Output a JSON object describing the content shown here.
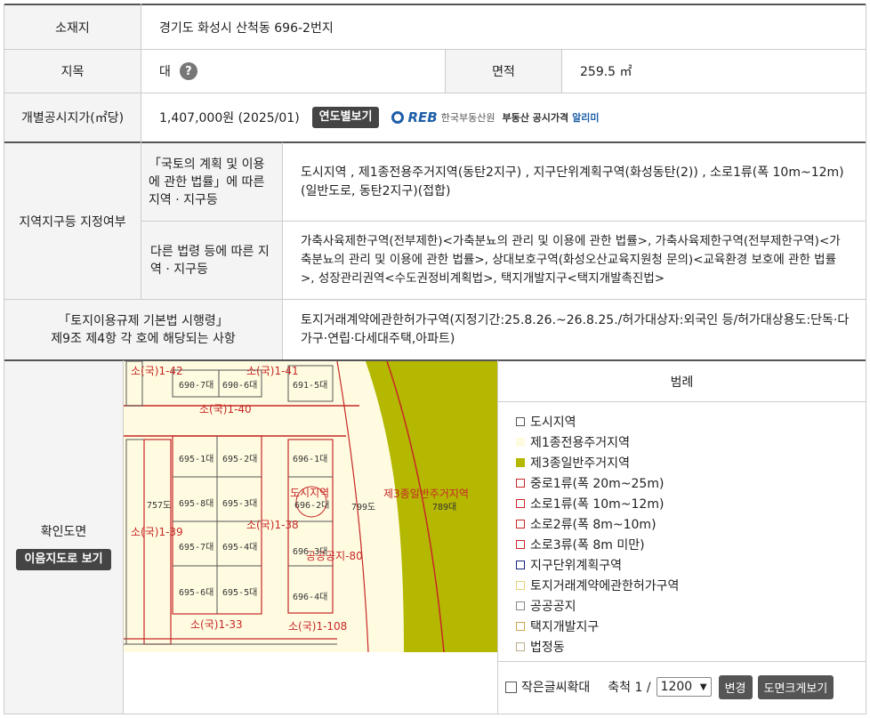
{
  "location": {
    "label": "소재지",
    "value": "경기도 화성시 산척동 696-2번지"
  },
  "jimok": {
    "label": "지목",
    "value": "대",
    "help": "?"
  },
  "area": {
    "label": "면적",
    "value": "259.5 ㎡"
  },
  "price": {
    "label": "개별공시지가(㎡당)",
    "value": "1,407,000원 (2025/01)",
    "button": "연도별보기",
    "reb_logo": "REB",
    "reb_org": "한국부동산원",
    "reb_service": "부동산 공시가격",
    "reb_alimi": "알리미"
  },
  "zoning": {
    "label": "지역지구등 지정여부",
    "national_label": "「국토의 계획 및 이용에 관한 법률」에 따른 지역 · 지구등",
    "national_value": "도시지역 , 제1종전용주거지역(동탄2지구) , 지구단위계획구역(화성동탄(2)) , 소로1류(폭 10m~12m)(일반도로, 동탄2지구)(접합)",
    "other_label": "다른 법령 등에 따른 지역 · 지구등",
    "other_value": "가축사육제한구역(전부제한)<가축분뇨의 관리 및 이용에 관한 법률>, 가축사육제한구역(전부제한구역)<가축분뇨의 관리 및 이용에 관한 법률>, 상대보호구역(화성오산교육지원청 문의)<교육환경 보호에 관한 법률>, 성장관리권역<수도권정비계획법>, 택지개발지구<택지개발촉진법>"
  },
  "regulation": {
    "label_line1": "「토지이용규제 기본법 시행령」",
    "label_line2": "제9조 제4항 각 호에 해당되는 사항",
    "value": "토지거래계약에관한허가구역(지정기간:25.8.26.~26.8.25./허가대상자:외국인 등/허가대상용도:단독·다가구·연립·다세대주택,아파트)"
  },
  "map_section": {
    "label": "확인도면",
    "button": "이음지도로 보기"
  },
  "map_labels": {
    "l1": "소(국)1-42",
    "l2": "소(국)1-41",
    "l3": "소(국)1-40",
    "l4": "소(국)1-39",
    "l5": "소(국)1-38",
    "l6": "소(국)1-33",
    "l7": "소(국)1-108",
    "l8": "공공공지-80",
    "l9": "도시지역",
    "l10": "제3종일반주거지역",
    "p1": "690-7대",
    "p2": "690-6대",
    "p3": "691-5대",
    "p4": "695-1대",
    "p5": "695-2대",
    "p6": "696-1대",
    "p7": "695-8대",
    "p8": "695-3대",
    "p9": "696-2대",
    "p10": "695-7대",
    "p11": "695-4대",
    "p12": "696-3대",
    "p13": "695-6대",
    "p14": "695-5대",
    "p15": "696-4대",
    "p16": "757도",
    "p17": "799도",
    "p18": "789대"
  },
  "legend": {
    "title": "범례",
    "items": [
      {
        "label": "도시지역",
        "fill": "#ffffff",
        "border": "#555555"
      },
      {
        "label": "제1종전용주거지역",
        "fill": "#fffbe0",
        "border": "#fffbe0"
      },
      {
        "label": "제3종일반주거지역",
        "fill": "#b5b800",
        "border": "#b5b800"
      },
      {
        "label": "중로1류(폭 20m~25m)",
        "fill": "#ffffff",
        "border": "#c62828"
      },
      {
        "label": "소로1류(폭 10m~12m)",
        "fill": "#ffffff",
        "border": "#c62828"
      },
      {
        "label": "소로2류(폭 8m~10m)",
        "fill": "#ffffff",
        "border": "#c62828"
      },
      {
        "label": "소로3류(폭 8m 미만)",
        "fill": "#ffffff",
        "border": "#c62828"
      },
      {
        "label": "지구단위계획구역",
        "fill": "#ffffff",
        "border": "#1a237e"
      },
      {
        "label": "토지거래계약에관한허가구역",
        "fill": "#ffffff",
        "border": "#e6d27a"
      },
      {
        "label": "공공공지",
        "fill": "#ffffff",
        "border": "#888888"
      },
      {
        "label": "택지개발지구",
        "fill": "#ffffff",
        "border": "#c9a64a"
      },
      {
        "label": "법정동",
        "fill": "#ffffff",
        "border": "#bbaa88"
      }
    ]
  },
  "map_controls": {
    "small_text_label": "작은글씨확대",
    "scale_label": "축척 1 /",
    "scale_value": "1200",
    "scale_options": [
      "1200"
    ],
    "change_button": "변경",
    "enlarge_button": "도면크게보기"
  }
}
